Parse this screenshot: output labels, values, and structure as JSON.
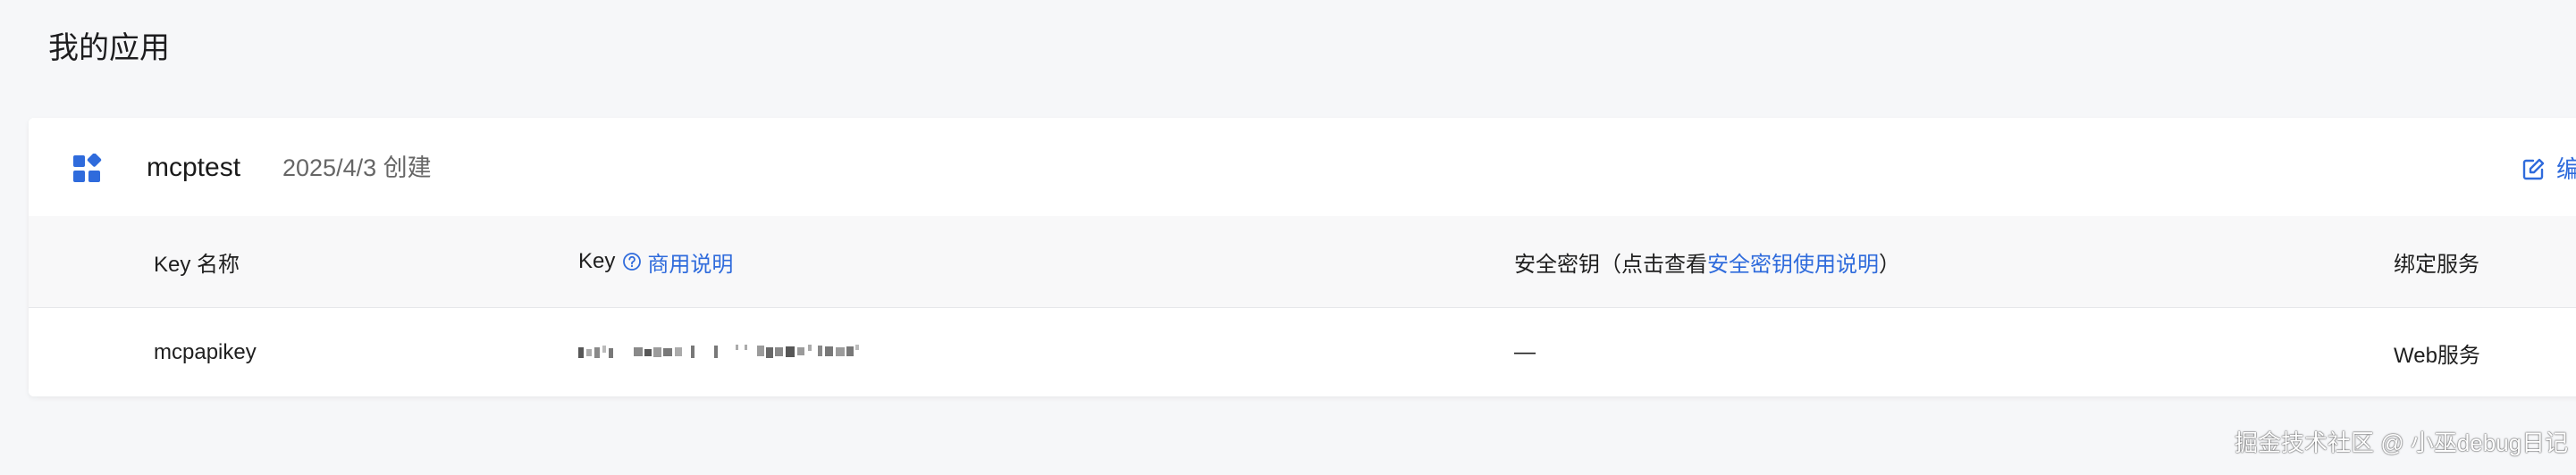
{
  "page": {
    "title": "我的应用"
  },
  "app": {
    "name": "mcptest",
    "created": "2025/4/3 创建",
    "edit_label": "编辑",
    "icon": "app-grid-icon",
    "accent_color": "#2f6bdc"
  },
  "table": {
    "headers": {
      "key_name": "Key 名称",
      "key": "Key",
      "key_link": "商用说明",
      "secret_prefix": "安全密钥（点击查看",
      "secret_link": "安全密钥使用说明",
      "secret_suffix": "）",
      "bound_service": "绑定服务"
    },
    "rows": [
      {
        "key_name": "mcpapikey",
        "key_masked": true,
        "secret": "—",
        "bound_service": "Web服务"
      }
    ]
  },
  "watermark": {
    "text": "掘金技术社区 @ 小巫debug日记"
  }
}
